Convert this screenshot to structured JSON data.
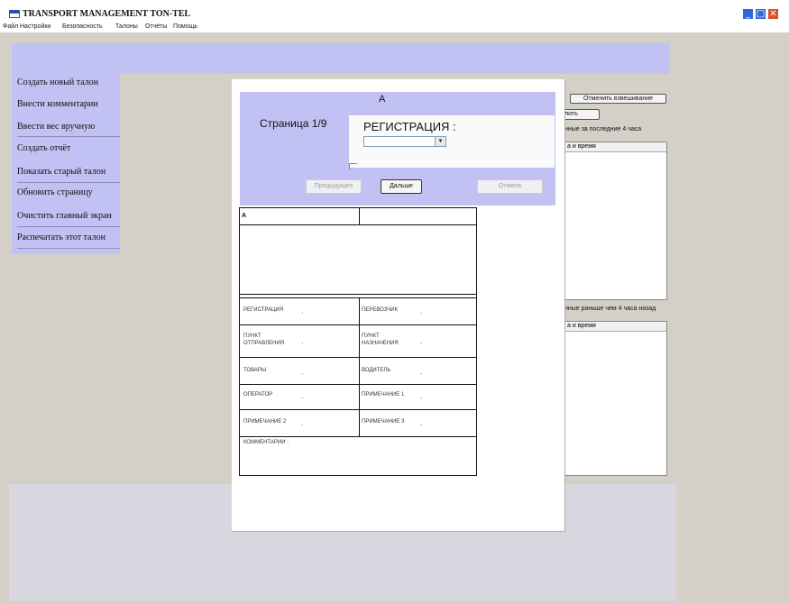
{
  "window": {
    "title": "TRANSPORT MANAGEMENT TON-TEL",
    "controls": {
      "minimize": "_",
      "maximize": "□",
      "close": "✕"
    }
  },
  "menu": [
    "Файл",
    "Настройки",
    "Безопасность",
    "Талоны",
    "Отчёты",
    "Помощь"
  ],
  "sidebar": {
    "items": [
      "Создать новый талон",
      "Внести комментарии",
      "Ввести вес вручную",
      "Создать отчёт",
      "Показать старый талон",
      "Обновить страницу",
      "Очистить главный экран",
      "Распечатать этот талон"
    ]
  },
  "right_panel": {
    "cancel_weighing_button": "Отменить взвешивание",
    "partial_button": "лить",
    "recent_label": "нные за последние 4 часа",
    "recent_col": "а и время",
    "older_label": "нные раньше чем 4 часа назад",
    "older_col": "а и время"
  },
  "modal": {
    "title": "А",
    "page_indicator": "Страница 1/9",
    "registration_label": "РЕГИСТРАЦИЯ :",
    "registration_value": "",
    "prev_button": "Предыдущее",
    "next_button": "Дальше",
    "cancel_button": "Отмена"
  },
  "ticket": {
    "header_left": "А",
    "fields": [
      {
        "left": "РЕГИСТРАЦИЯ",
        "right": "ПЕРЕВОЗЧИК"
      },
      {
        "left": "ПУНКТ\nОТПРАВЛЕНИЯ",
        "right": "ПУНКТ\nНАЗНАЧЕНИЯ"
      },
      {
        "left": "ТОВАРЫ",
        "right": "ВОДИТЕЛЬ"
      },
      {
        "left": "ОПЕРАТОР",
        "right": "ПРИМЕЧАНИЕ 1"
      },
      {
        "left": "ПРИМЕЧАНИЕ 2",
        "right": "ПРИМЕЧАНИЕ 3"
      }
    ],
    "comments_label": "КОММЕНТАРИИ :",
    "field_separator": "."
  },
  "colors": {
    "accent": "#c2c1f4",
    "window_bg": "#d4d0c8",
    "titlebar_blue": "#3168d8",
    "close_red": "#d8502c"
  }
}
